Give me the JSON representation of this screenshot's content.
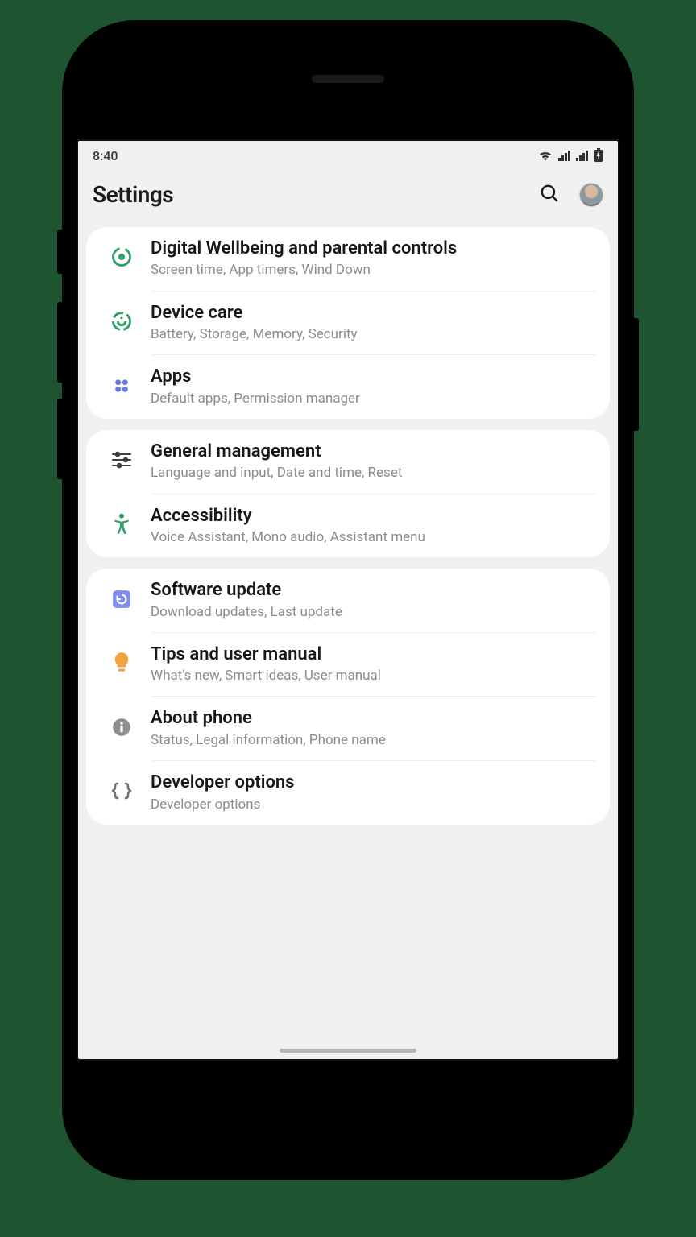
{
  "status": {
    "time": "8:40"
  },
  "header": {
    "title": "Settings"
  },
  "groups": [
    {
      "items": [
        {
          "key": "wellbeing",
          "title": "Digital Wellbeing and parental controls",
          "subtitle": "Screen time, App timers, Wind Down"
        },
        {
          "key": "devicecare",
          "title": "Device care",
          "subtitle": "Battery, Storage, Memory, Security"
        },
        {
          "key": "apps",
          "title": "Apps",
          "subtitle": "Default apps, Permission manager"
        }
      ]
    },
    {
      "items": [
        {
          "key": "general",
          "title": "General management",
          "subtitle": "Language and input, Date and time, Reset"
        },
        {
          "key": "accessibility",
          "title": "Accessibility",
          "subtitle": "Voice Assistant, Mono audio, Assistant menu"
        }
      ]
    },
    {
      "items": [
        {
          "key": "software",
          "title": "Software update",
          "subtitle": "Download updates, Last update"
        },
        {
          "key": "tips",
          "title": "Tips and user manual",
          "subtitle": "What's new, Smart ideas, User manual"
        },
        {
          "key": "about",
          "title": "About phone",
          "subtitle": "Status, Legal information, Phone name"
        },
        {
          "key": "developer",
          "title": "Developer options",
          "subtitle": "Developer options"
        }
      ]
    }
  ]
}
